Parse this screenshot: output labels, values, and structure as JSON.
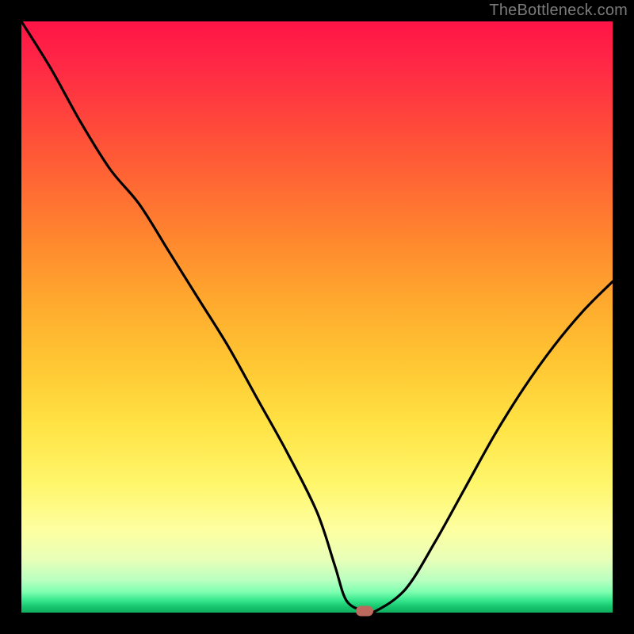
{
  "watermark": "TheBottleneck.com",
  "colors": {
    "frame": "#000000",
    "curve": "#000000",
    "marker": "#bd6a5e"
  },
  "chart_data": {
    "type": "line",
    "title": "",
    "xlabel": "",
    "ylabel": "",
    "xlim": [
      0,
      100
    ],
    "ylim": [
      0,
      100
    ],
    "grid": false,
    "legend": false,
    "series": [
      {
        "name": "bottleneck-curve",
        "x": [
          0,
          5,
          10,
          15,
          20,
          25,
          30,
          35,
          40,
          45,
          50,
          53,
          55,
          58,
          60,
          65,
          70,
          75,
          80,
          85,
          90,
          95,
          100
        ],
        "values": [
          100,
          92,
          83,
          75,
          69,
          61,
          53,
          45,
          36,
          27,
          17,
          8,
          2,
          0.3,
          0.3,
          4,
          12,
          21,
          30,
          38,
          45,
          51,
          56
        ]
      }
    ],
    "marker": {
      "x": 58,
      "y": 0.3
    },
    "background_gradient_stops": [
      {
        "pos": 0,
        "color": "#ff1447"
      },
      {
        "pos": 0.5,
        "color": "#ffc733"
      },
      {
        "pos": 0.86,
        "color": "#fdffa0"
      },
      {
        "pos": 1.0,
        "color": "#0fae5f"
      }
    ]
  }
}
